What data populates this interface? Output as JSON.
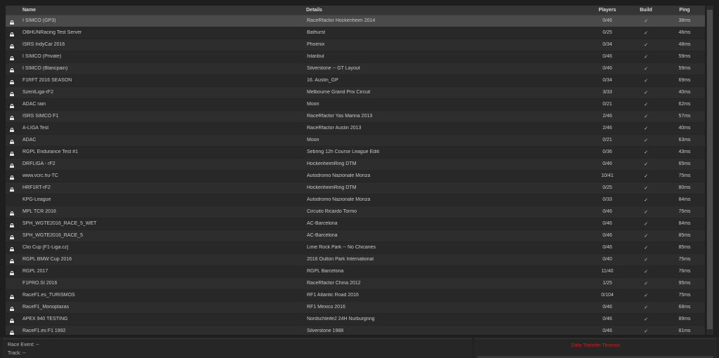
{
  "table": {
    "columns": {
      "name": "Name",
      "details": "Details",
      "players": "Players",
      "build": "Build",
      "ping": "Ping"
    },
    "selected_row": 0,
    "rows": [
      {
        "locked": true,
        "name": "I SIMCO (GP3)",
        "details": "RaceRfactor Hockenheim 2014",
        "players": "0/46",
        "build": "✓",
        "ping": "38ms"
      },
      {
        "locked": true,
        "name": "OBHUNRacing Test Server",
        "details": "Bathurst",
        "players": "0/25",
        "build": "✓",
        "ping": "46ms"
      },
      {
        "locked": true,
        "name": "ISRS IndyCar 2016",
        "details": "Phoenix",
        "players": "0/34",
        "build": "✓",
        "ping": "48ms"
      },
      {
        "locked": true,
        "name": "I SIMCO (Private)",
        "details": "Istanbul",
        "players": "0/46",
        "build": "✓",
        "ping": "59ms"
      },
      {
        "locked": true,
        "name": "I SIMCO (Blancpain)",
        "details": "Silverstone -- GT Layout",
        "players": "0/46",
        "build": "✓",
        "ping": "59ms"
      },
      {
        "locked": true,
        "name": "F1RFT 2016 SEASON",
        "details": "16. Austin_GP",
        "players": "0/34",
        "build": "✓",
        "ping": "69ms"
      },
      {
        "locked": true,
        "name": "SzentLiga-rF2",
        "details": "Melbourne Grand Prix Circuit",
        "players": "3/33",
        "build": "✓",
        "ping": "40ms"
      },
      {
        "locked": true,
        "name": "ADAC rain",
        "details": "Moon",
        "players": "0/21",
        "build": "✓",
        "ping": "62ms"
      },
      {
        "locked": true,
        "name": "ISRS SIMCO F1",
        "details": "RaceRfactor Yas Marina 2013",
        "players": "2/46",
        "build": "✓",
        "ping": "57ms"
      },
      {
        "locked": true,
        "name": "A-LIGA Test",
        "details": "RaceRfactor Austin 2013",
        "players": "2/46",
        "build": "✓",
        "ping": "40ms"
      },
      {
        "locked": true,
        "name": "ADAC",
        "details": "Moon",
        "players": "0/21",
        "build": "✓",
        "ping": "63ms"
      },
      {
        "locked": true,
        "name": "RGPL Endurance Test #1",
        "details": "Sebring 12h Course League Editi",
        "players": "0/36",
        "build": "✓",
        "ping": "43ms"
      },
      {
        "locked": true,
        "name": "DRFLIGA - rF2",
        "details": "HockenheimRing DTM",
        "players": "0/46",
        "build": "✓",
        "ping": "65ms"
      },
      {
        "locked": true,
        "name": "www.vcrc.hu-TC",
        "details": "Autodromo Nazionale Monza",
        "players": "10/41",
        "build": "✓",
        "ping": "75ms"
      },
      {
        "locked": true,
        "name": "HRF1RT-rF2",
        "details": "HockenheimRing DTM",
        "players": "0/25",
        "build": "✓",
        "ping": "80ms"
      },
      {
        "locked": false,
        "name": "KPG-League",
        "details": "Autodromo Nazionale Monza",
        "players": "0/33",
        "build": "✓",
        "ping": "84ms"
      },
      {
        "locked": true,
        "name": "MPL TCR 2016",
        "details": "Circuito Ricardo Tormo",
        "players": "0/46",
        "build": "✓",
        "ping": "75ms"
      },
      {
        "locked": true,
        "name": "SPH_WGTE2016_RACE_5_WET",
        "details": "AC-Barcelona",
        "players": "0/46",
        "build": "✓",
        "ping": "84ms"
      },
      {
        "locked": true,
        "name": "SPH_WGTE2016_RACE_5",
        "details": "AC-Barcelona",
        "players": "0/46",
        "build": "✓",
        "ping": "85ms"
      },
      {
        "locked": true,
        "name": "Clio Cup [F1-Liga.cz]",
        "details": "Lime Rock Park -- No Chicanes",
        "players": "0/46",
        "build": "✓",
        "ping": "85ms"
      },
      {
        "locked": true,
        "name": "RGPL BMW Cup 2016",
        "details": "2016 Oulton Park International",
        "players": "0/40",
        "build": "✓",
        "ping": "75ms"
      },
      {
        "locked": true,
        "name": "RGPL 2017",
        "details": "RGPL Barcelona",
        "players": "11/40",
        "build": "✓",
        "ping": "76ms"
      },
      {
        "locked": false,
        "name": "F1PRO.SI 2016",
        "details": "RaceRfactor China 2012",
        "players": "1/25",
        "build": "✓",
        "ping": "95ms"
      },
      {
        "locked": true,
        "name": "RaceF1.es_TURISMOS",
        "details": "RF1 Atlantic Road 2016",
        "players": "0/104",
        "build": "✓",
        "ping": "75ms"
      },
      {
        "locked": true,
        "name": "RaceF1_Monoplazas",
        "details": "RF1 Mexico 2016",
        "players": "0/46",
        "build": "✓",
        "ping": "68ms"
      },
      {
        "locked": true,
        "name": "APEX 940 TESTING",
        "details": "Nordschleife2 24H Nurburgring",
        "players": "0/46",
        "build": "✓",
        "ping": "89ms"
      },
      {
        "locked": true,
        "name": "RaceF1.es F1 1992",
        "details": "Silverstone 1988",
        "players": "0/46",
        "build": "✓",
        "ping": "81ms"
      }
    ]
  },
  "race_info": {
    "event": "Race Event: --",
    "track": "Track: --"
  },
  "status": {
    "message": "Data Transfer Timeout",
    "color": "#d21c1c"
  },
  "icons": {
    "lock": "lock-icon",
    "build_ok": "checkmark-icon"
  }
}
